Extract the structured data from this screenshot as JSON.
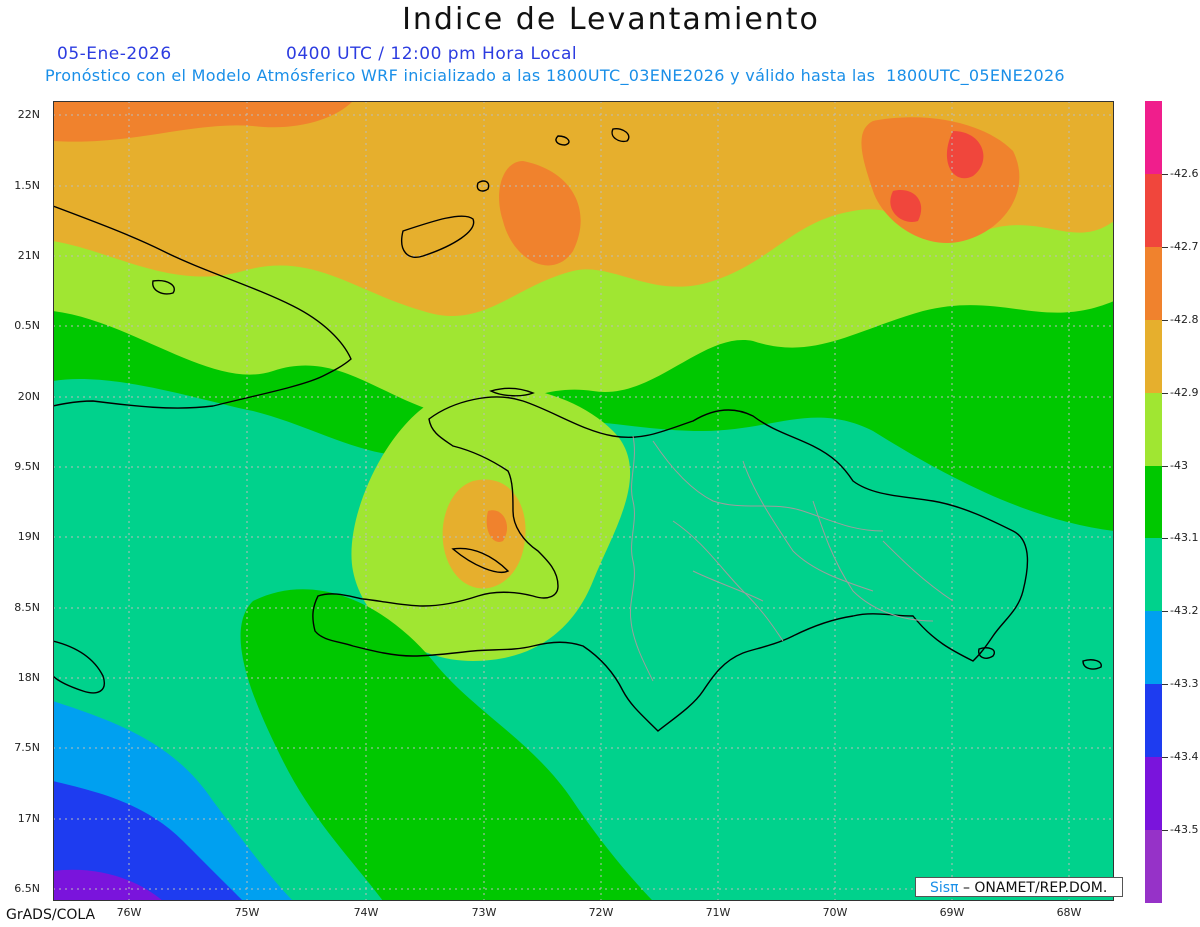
{
  "title": "Indice de Levantamiento",
  "header": {
    "date": "05-Ene-2026",
    "time": "0400 UTC / 12:00 pm Hora Local",
    "forecast_line": "Pronóstico con el Modelo Atmósferico WRF inicializado a las 1800UTC_03ENE2026 y válido hasta las  1800UTC_05ENE2026"
  },
  "lat_labels": [
    "22N",
    "1.5N",
    "21N",
    "0.5N",
    "20N",
    "9.5N",
    "19N",
    "8.5N",
    "18N",
    "7.5N",
    "17N",
    "6.5N"
  ],
  "lon_labels": [
    "76W",
    "75W",
    "74W",
    "73W",
    "72W",
    "71W",
    "70W",
    "69W",
    "68W"
  ],
  "colorbar": {
    "labels": [
      "-42.6",
      "-42.7",
      "-42.8",
      "-42.9",
      "-43",
      "-43.1",
      "-43.2",
      "-43.3",
      "-43.4",
      "-43.5"
    ],
    "colors": [
      "#f01e8c",
      "#f0463c",
      "#f0822d",
      "#e6af2d",
      "#a0e632",
      "#00c800",
      "#00d28c",
      "#00a0f0",
      "#1e3cf0",
      "#7a14dc",
      "#9632c8"
    ]
  },
  "footer": {
    "grads": "GrADS/COLA",
    "logo_sis": "Sisπ",
    "logo_rest": " – ONAMET/REP.DOM."
  }
}
